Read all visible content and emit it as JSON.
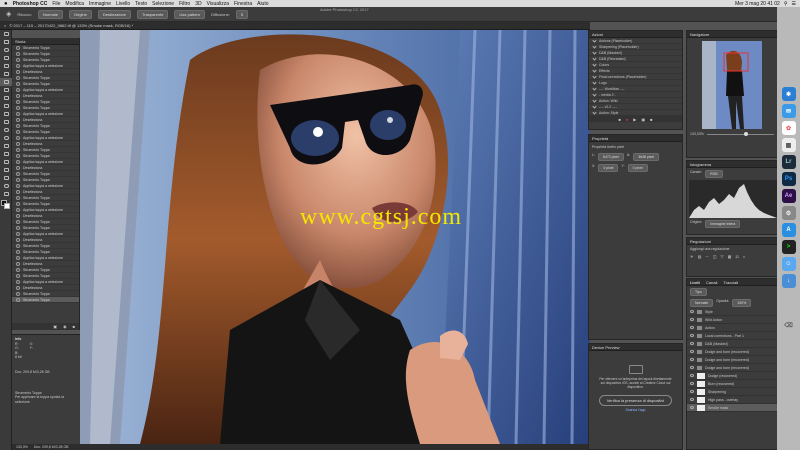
{
  "menubar": {
    "apple": "",
    "app_name": "Photoshop CC",
    "items": [
      "File",
      "Modifica",
      "Immagine",
      "Livello",
      "Testo",
      "Selezione",
      "Filtro",
      "3D",
      "Visualizza",
      "Finestra",
      "Aiuto"
    ],
    "clock": "Mer 3 mag  20 41 02"
  },
  "window_title": "Adobe Photoshop CC 2017",
  "options": {
    "mode_label": "Ritocco:",
    "mode_value": "Normale",
    "source": "Origine",
    "destination": "Destinazione",
    "transparent": "Trasparente",
    "use_pattern": "Usa pattern",
    "diffusion_label": "Diffusione:",
    "diffusion_value": "5"
  },
  "doc_tab": "© 2017 – 115 – 20170422_0862.tif @ 133% (Smoke mask, RGB/16) *",
  "history": {
    "title": "Storia",
    "items": [
      "Strumento Toppa",
      "Strumento Toppa",
      "Strumento Toppa",
      "Applica toppa a selezione",
      "Deseleziona",
      "Strumento Toppa",
      "Strumento Toppa",
      "Applica toppa a selezione",
      "Deseleziona",
      "Strumento Toppa",
      "Strumento Toppa",
      "Applica toppa a selezione",
      "Deseleziona",
      "Strumento Toppa",
      "Strumento Toppa",
      "Applica toppa a selezione",
      "Deseleziona",
      "Strumento Toppa",
      "Strumento Toppa",
      "Applica toppa a selezione",
      "Deseleziona",
      "Strumento Toppa",
      "Strumento Toppa",
      "Applica toppa a selezione",
      "Deseleziona",
      "Strumento Toppa",
      "Strumento Toppa",
      "Applica toppa a selezione",
      "Deseleziona",
      "Strumento Toppa",
      "Strumento Toppa",
      "Applica toppa a selezione",
      "Deseleziona",
      "Strumento Toppa",
      "Strumento Toppa",
      "Applica toppa a selezione",
      "Deseleziona",
      "Strumento Toppa",
      "Strumento Toppa",
      "Applica toppa a selezione",
      "Deseleziona",
      "Strumento Toppa",
      "Strumento Toppa"
    ],
    "selected_index": 42
  },
  "info": {
    "title": "Info",
    "lines": [
      "R:",
      "G:",
      "B:",
      "8 bit",
      "X:",
      "Y:",
      "Doc: 209,8 M/3,28 GB",
      "Strumento Toppa",
      "Per applicare la toppa sposta la selezione"
    ]
  },
  "status": {
    "zoom": "133,3%",
    "doc": "Doc: 209,8 M/3,28 GB"
  },
  "actions": {
    "title": "Azioni",
    "items": [
      "Actions (Placeholder)",
      "Sharpening (Placeholder)",
      "D&B (Masked)",
      "D&B (Recreated)",
      "Colors",
      "Effects",
      "Final corrections (Placeholder)",
      "Logo",
      "---- Workflow ----",
      "- media 2 -",
      "Action: Wild",
      "---- v2.2 ----",
      "Action: Style"
    ]
  },
  "properties": {
    "title": "Proprietà",
    "subtitle": "Proprietà livello pixel",
    "w_label": "L:",
    "w_value": "5472 pixel",
    "h_label": "A:",
    "h_value": "3648 pixel",
    "x_label": "X:",
    "x_value": "0 pixel",
    "y_label": "Y:",
    "y_value": "0 pixel"
  },
  "device_preview": {
    "title": "Device Preview",
    "text": "Per ottenere un'anteprima dei layout direttamente sul dispositivo iOS, accedi al Creative Cloud sul dispositivo.",
    "button": "Verifica la presenza di dispositivi",
    "link": "Scarica l'app"
  },
  "navigator": {
    "title": "Navigatore",
    "zoom": "133,33%"
  },
  "histogram": {
    "title": "Istogramma",
    "channel_label": "Canale:",
    "channel_value": "RGB",
    "source_label": "Origine:",
    "source_value": "Immagine intera"
  },
  "adjustments": {
    "title": "Regolazioni",
    "subtitle": "Aggiungi una regolazione"
  },
  "layers": {
    "tabs": [
      "Livelli",
      "Canali",
      "Tracciati"
    ],
    "kind": "Tipo",
    "blend": "Normale",
    "opacity_label": "Opacità:",
    "opacity_value": "100%",
    "items": [
      {
        "name": "Style",
        "type": "folder"
      },
      {
        "name": "Wild Action",
        "type": "folder"
      },
      {
        "name": "Action",
        "type": "folder"
      },
      {
        "name": "Local corrections - Part 1",
        "type": "folder"
      },
      {
        "name": "D&B (Masked)",
        "type": "folder"
      },
      {
        "name": "Dodge and burn (recovered)",
        "type": "folder"
      },
      {
        "name": "Dodge and burn (recovered)",
        "type": "folder"
      },
      {
        "name": "Dodge and burn (recovered)",
        "type": "folder"
      },
      {
        "name": "Dodge (recovered)",
        "type": "layer"
      },
      {
        "name": "Burn (recovered)",
        "type": "layer"
      },
      {
        "name": "Sharpening",
        "type": "layer"
      },
      {
        "name": "High pass - overlay",
        "type": "layer"
      },
      {
        "name": "Smoke mask",
        "type": "layer"
      }
    ],
    "selected_index": 12
  },
  "watermark": "www.cgtsj.com",
  "dock": {
    "items": [
      "Safari",
      "Mail",
      "Foto",
      "Lr",
      "Ps",
      "Ae",
      "Prefs",
      "Trash"
    ]
  }
}
